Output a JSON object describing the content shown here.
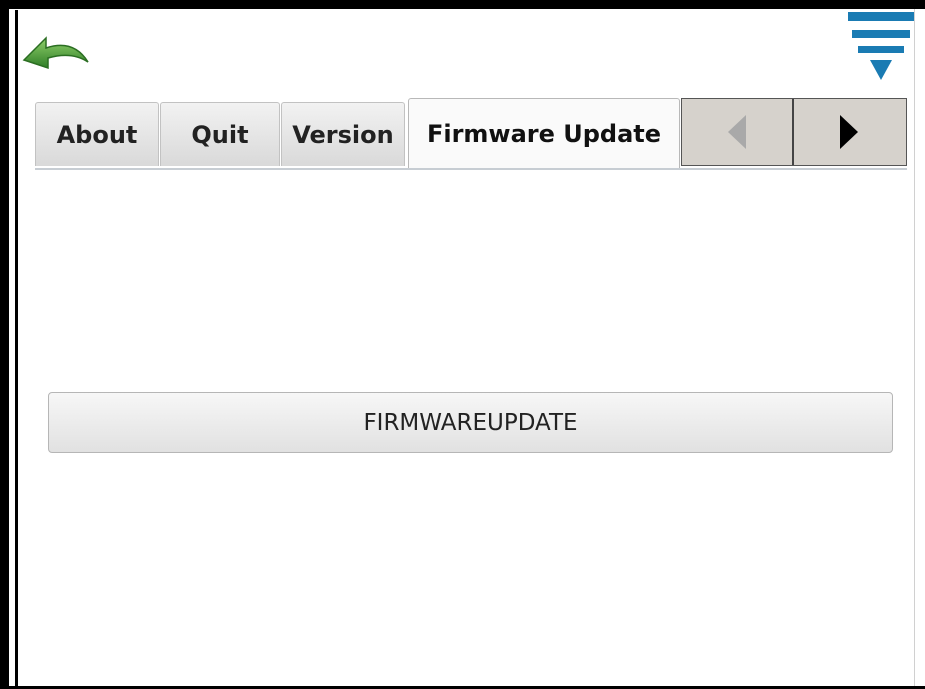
{
  "header": {
    "back_icon": "curved-back-arrow-icon",
    "menu_icon": "funnel-menu-icon",
    "back_color": "#4a9a3a",
    "menu_color": "#1a7bb3"
  },
  "tabs": [
    {
      "label": "About",
      "active": false
    },
    {
      "label": "Quit",
      "active": false
    },
    {
      "label": "Version",
      "active": false
    },
    {
      "label": "Firmware Update",
      "active": true
    }
  ],
  "tab_scroll": {
    "left_icon": "scroll-left-arrow-icon",
    "right_icon": "scroll-right-arrow-icon"
  },
  "main": {
    "firmware_button_label": "FIRMWAREUPDATE"
  }
}
